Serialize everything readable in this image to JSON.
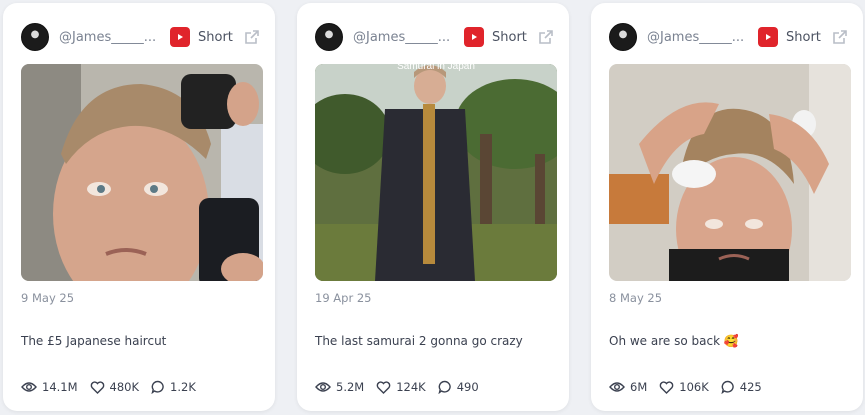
{
  "cards": [
    {
      "handle": "@James_____...",
      "platform_icon": "youtube-icon",
      "type_label": "Short",
      "date": "9 May 25",
      "caption": "The £5 Japanese haircut",
      "views": "14.1M",
      "likes": "480K",
      "comments": "1.2K"
    },
    {
      "handle": "@James_____...",
      "platform_icon": "youtube-icon",
      "type_label": "Short",
      "date": "19 Apr 25",
      "caption": "The last samurai 2 gonna go crazy",
      "overlay_text": "Samurai in Japan",
      "views": "5.2M",
      "likes": "124K",
      "comments": "490"
    },
    {
      "handle": "@James_____...",
      "platform_icon": "youtube-icon",
      "type_label": "Short",
      "date": "8 May 25",
      "caption": "Oh we are so back 🥰",
      "views": "6M",
      "likes": "106K",
      "comments": "425"
    }
  ],
  "colors": {
    "youtube_red": "#e0242b",
    "card_bg": "#ffffff",
    "page_bg": "#eef0f4"
  }
}
